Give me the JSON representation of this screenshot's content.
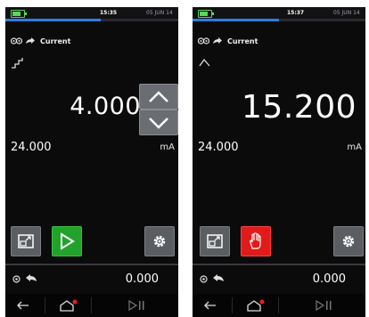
{
  "screens": [
    {
      "status": {
        "time": "15:35",
        "date": "05 JUN 14",
        "progress_pct": 55
      },
      "mode_label": "Current",
      "main_value": "4.000",
      "measured_value": "24.000",
      "unit": "mA",
      "secondary_value": "0.000",
      "buttons": [
        "scale-button",
        "play-button",
        "settings-button"
      ]
    },
    {
      "status": {
        "time": "15:37",
        "date": "05 JUN 14",
        "progress_pct": 50
      },
      "mode_label": "Current",
      "main_value": "15.200",
      "measured_value": "24.000",
      "unit": "mA",
      "secondary_value": "0.000",
      "buttons": [
        "scale-button",
        "stop-hand-button",
        "settings-button"
      ]
    }
  ],
  "colors": {
    "progress": "#2e7de0",
    "play": "#21a22a",
    "stop": "#e11b1b",
    "button_grey": "#5a5d61"
  },
  "icons": {
    "status": [
      "battery-icon"
    ],
    "mode": [
      "loop-icon",
      "output-arrow-icon"
    ],
    "waveform_left": "step-wave-icon",
    "waveform_right": "ramp-wave-icon",
    "spinner": [
      "chevron-up-icon",
      "chevron-down-icon"
    ],
    "secondary": [
      "channel-icon",
      "source-icon"
    ],
    "nav": [
      "back-arrow-icon",
      "home-icon",
      "play-pause-icon"
    ]
  }
}
